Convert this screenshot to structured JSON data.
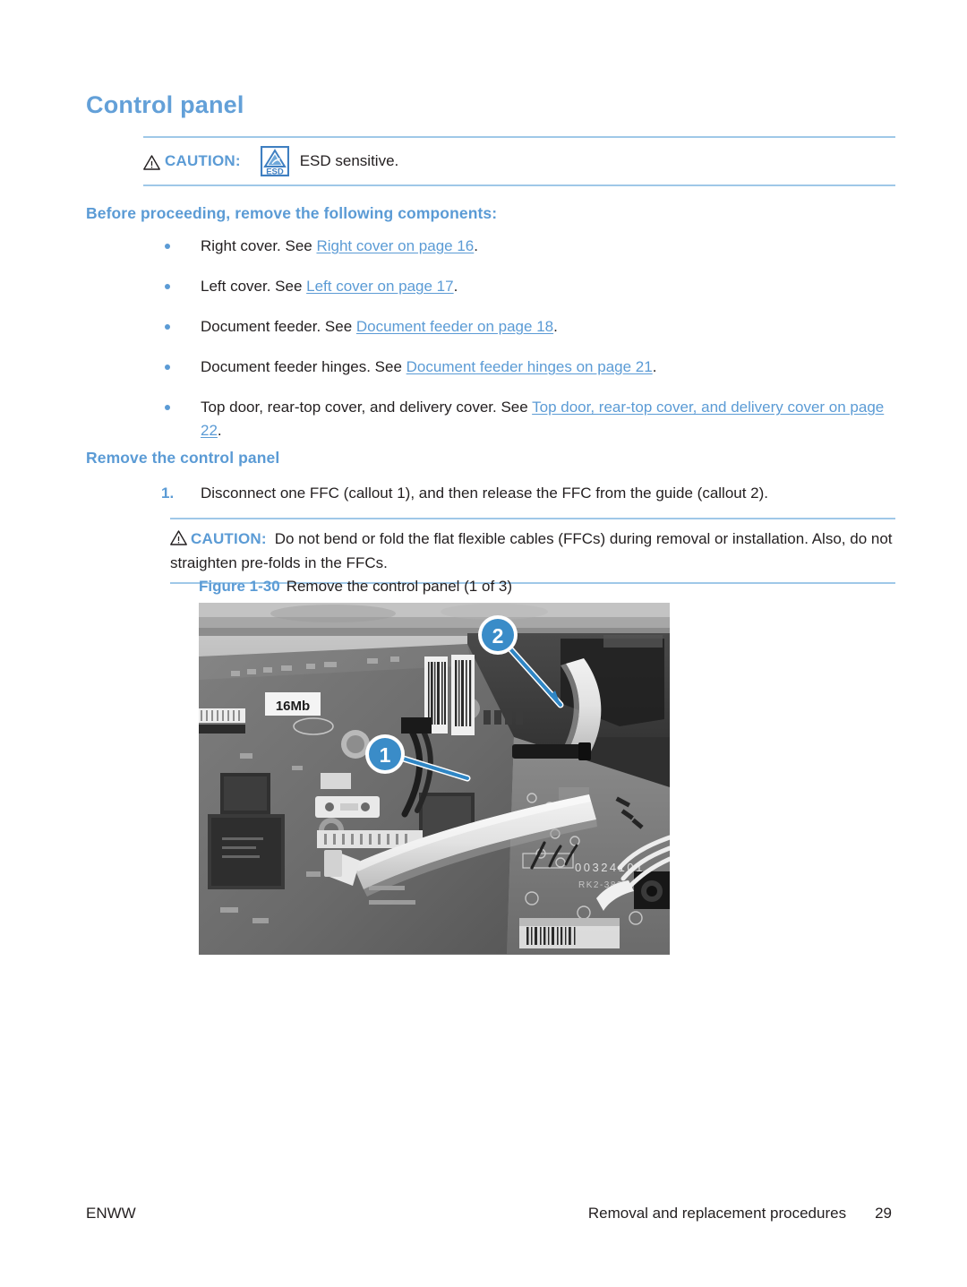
{
  "page": {
    "heading": "Control panel",
    "accent_color": "#5b9bd5",
    "rule_color": "#9fc8e8",
    "text_color": "#231f20"
  },
  "esd_note": {
    "warning_icon": "warning-triangle-icon",
    "caution_label": "CAUTION:",
    "badge_icon": "esd-sensitive-icon",
    "badge_text": "ESD",
    "text": "ESD sensitive."
  },
  "before_proceeding": {
    "heading": "Before proceeding, remove the following components:",
    "items": [
      {
        "lead": "Right cover. See ",
        "link": "Right cover on page 16",
        "tail": "."
      },
      {
        "lead": "Left cover. See ",
        "link": "Left cover on page 17",
        "tail": "."
      },
      {
        "lead": "Document feeder. See ",
        "link": "Document feeder on page 18",
        "tail": "."
      },
      {
        "lead": "Document feeder hinges. See ",
        "link": "Document feeder hinges on page 21",
        "tail": "."
      },
      {
        "lead": "Top door, rear-top cover, and delivery cover. See ",
        "link": "Top door, rear-top cover, and delivery cover on page 22",
        "tail": "."
      }
    ]
  },
  "remove_section": {
    "heading": "Remove the control panel",
    "step_number": "1.",
    "step_text": "Disconnect one FFC (callout 1), and then release the FFC from the guide (callout 2)."
  },
  "ffc_note": {
    "warning_icon": "warning-triangle-icon",
    "caution_label": "CAUTION:",
    "text": "Do not bend or fold the flat flexible cables (FFCs) during removal or installation. Also, do not straighten pre-folds in the FFCs."
  },
  "figure": {
    "number": "Figure 1-30",
    "title": "Remove the control panel (1 of 3)",
    "description": "Grayscale photograph of a printer formatter printed circuit board with flat flexible cables",
    "labels": {
      "memory_sticker": "16Mb",
      "board_serial": "00324101",
      "board_part": "RK2-3838"
    },
    "callouts": [
      {
        "number": "1",
        "meaning": "FFC connector to disconnect"
      },
      {
        "number": "2",
        "meaning": "FFC guide to release from"
      }
    ],
    "callout_color": "#3a8cc8"
  },
  "footer": {
    "left": "ENWW",
    "section": "Removal and replacement procedures",
    "page_number": "29"
  }
}
